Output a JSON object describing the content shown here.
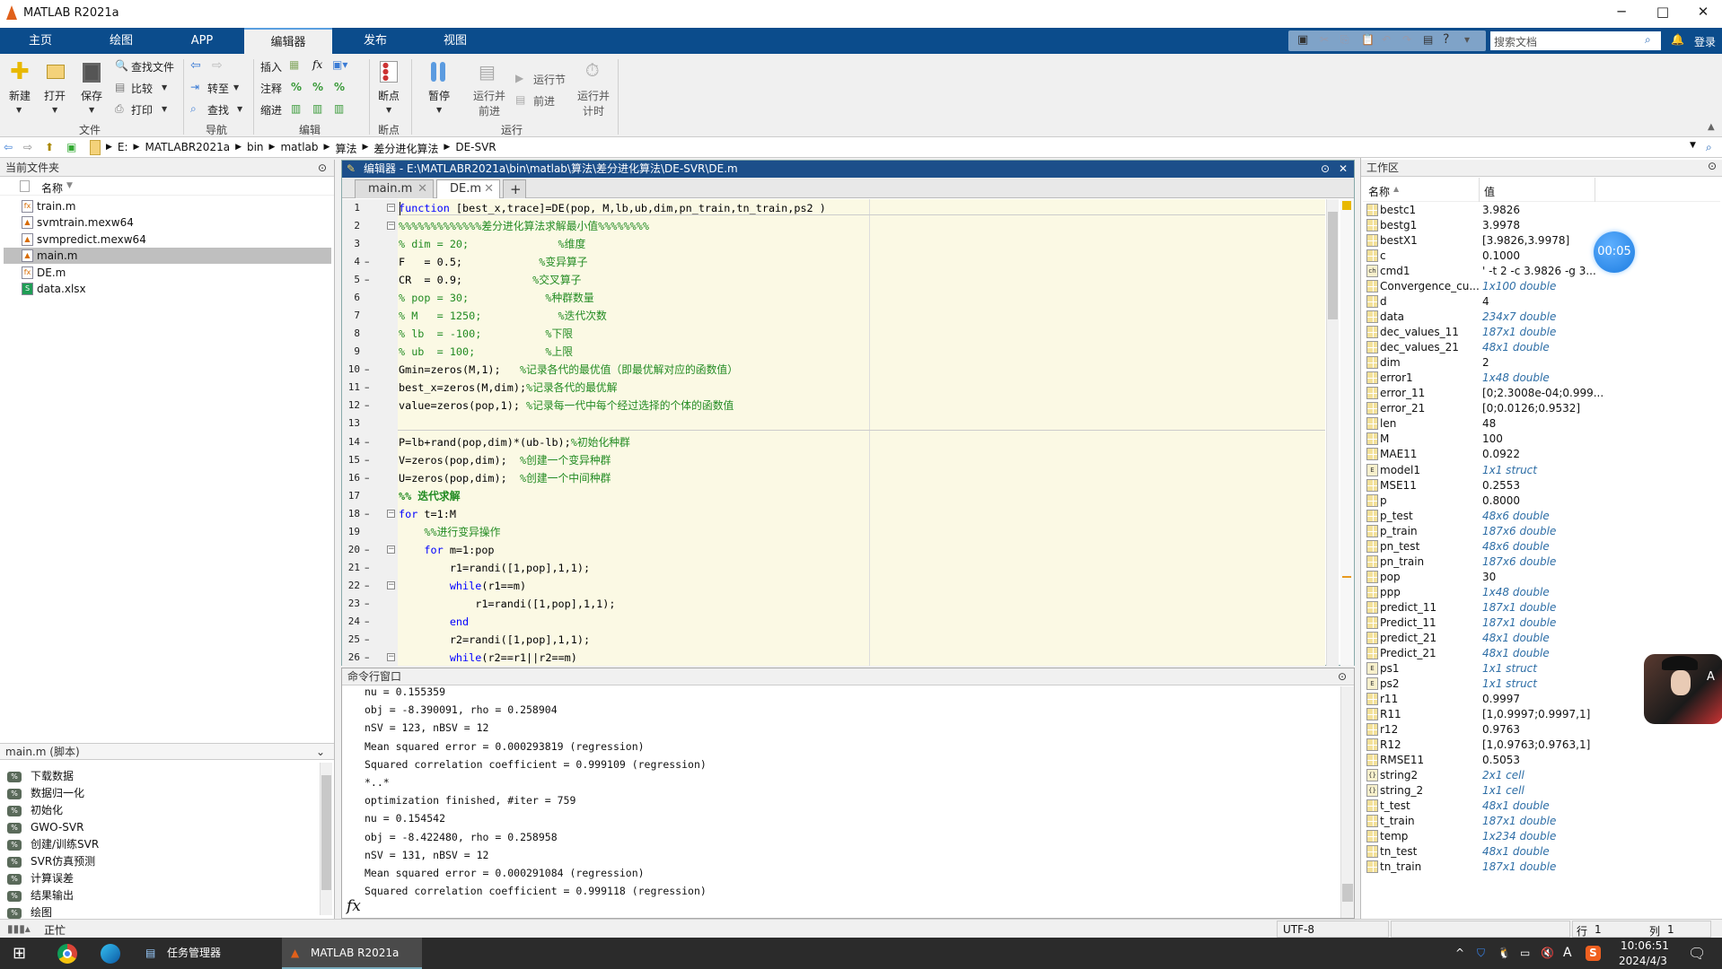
{
  "app": {
    "title": "MATLAB R2021a",
    "window_controls": {
      "minimize": "─",
      "maximize": "□",
      "close": "✕"
    }
  },
  "ribbon_tabs": [
    {
      "label": "主页"
    },
    {
      "label": "绘图"
    },
    {
      "label": "APP"
    },
    {
      "label": "编辑器",
      "selected": true
    },
    {
      "label": "发布"
    },
    {
      "label": "视图"
    }
  ],
  "quick_access": {
    "search_placeholder": "搜索文档",
    "login": "登录"
  },
  "ribbon": {
    "file": {
      "new": "新建",
      "open": "打开",
      "save": "保存",
      "find_files": "查找文件",
      "compare": "比较",
      "print": "打印",
      "group": "文件"
    },
    "nav": {
      "goto": "转至",
      "find": "查找",
      "group": "导航"
    },
    "edit": {
      "insert": "插入",
      "fx": "fx",
      "comment": "注释",
      "indent": "缩进",
      "group": "编辑",
      "percent": "%"
    },
    "breakpoints": {
      "label": "断点",
      "group": "断点"
    },
    "run": {
      "pause": "暂停",
      "run_advance_1": "运行并",
      "run_advance_2": "前进",
      "run_section": "运行节",
      "advance": "前进",
      "run_time_1": "运行并",
      "run_time_2": "计时",
      "group": "运行"
    }
  },
  "address": {
    "crumbs": [
      "E:",
      "MATLABR2021a",
      "bin",
      "matlab",
      "算法",
      "差分进化算法",
      "DE-SVR"
    ]
  },
  "current_folder": {
    "title": "当前文件夹",
    "column": "名称",
    "files": [
      {
        "name": "train.m",
        "icon": "function-file"
      },
      {
        "name": "svmtrain.mexw64",
        "icon": "mex-file"
      },
      {
        "name": "svmpredict.mexw64",
        "icon": "mex-file"
      },
      {
        "name": "main.m",
        "icon": "script-file",
        "selected": true
      },
      {
        "name": "DE.m",
        "icon": "function-file"
      },
      {
        "name": "data.xlsx",
        "icon": "excel-file"
      }
    ]
  },
  "details": {
    "title": "main.m  (脚本)",
    "sections": [
      "下载数据",
      "数据归一化",
      "初始化",
      "GWO-SVR",
      "创建/训练SVR",
      "SVR仿真预测",
      "计算误差",
      "结果输出",
      "绘图"
    ]
  },
  "editor": {
    "title": "编辑器 - E:\\MATLABR2021a\\bin\\matlab\\算法\\差分进化算法\\DE-SVR\\DE.m",
    "tabs": [
      {
        "label": "main.m"
      },
      {
        "label": "DE.m",
        "selected": true
      }
    ],
    "add_tab": "+",
    "lines": [
      {
        "n": "1",
        "fold": true,
        "s": [
          [
            "kw",
            "function"
          ],
          [
            "tx",
            " [best_x,trace]=DE(pop, M,lb,ub,dim,pn_train,tn_train,ps2 )"
          ]
        ]
      },
      {
        "n": "2",
        "fold": true,
        "s": [
          [
            "cm",
            "%%%%%%%%%%%%%差分进化算法求解最小值%%%%%%%%"
          ]
        ]
      },
      {
        "n": "3",
        "s": [
          [
            "cm",
            "% dim = 20;              %维度"
          ]
        ]
      },
      {
        "n": "4",
        "exec": true,
        "s": [
          [
            "tx",
            "F   = 0.5;            "
          ],
          [
            "cm",
            "%变异算子"
          ]
        ]
      },
      {
        "n": "5",
        "exec": true,
        "s": [
          [
            "tx",
            "CR  = 0.9;           "
          ],
          [
            "cm",
            "%交叉算子"
          ]
        ]
      },
      {
        "n": "6",
        "s": [
          [
            "cm",
            "% pop = 30;            %种群数量"
          ]
        ]
      },
      {
        "n": "7",
        "s": [
          [
            "cm",
            "% M   = 1250;            %迭代次数"
          ]
        ]
      },
      {
        "n": "8",
        "s": [
          [
            "cm",
            "% lb  = -100;          %下限"
          ]
        ]
      },
      {
        "n": "9",
        "s": [
          [
            "cm",
            "% ub  = 100;           %上限"
          ]
        ]
      },
      {
        "n": "10",
        "exec": true,
        "s": [
          [
            "tx",
            "Gmin=zeros(M,1);   "
          ],
          [
            "cm",
            "%记录各代的最优值（即最优解对应的函数值）"
          ]
        ]
      },
      {
        "n": "11",
        "exec": true,
        "s": [
          [
            "tx",
            "best_x=zeros(M,dim);"
          ],
          [
            "cm",
            "%记录各代的最优解"
          ]
        ]
      },
      {
        "n": "12",
        "exec": true,
        "s": [
          [
            "tx",
            "value=zeros(pop,1); "
          ],
          [
            "cm",
            "%记录每一代中每个经过选择的个体的函数值"
          ]
        ]
      },
      {
        "n": "13",
        "s": []
      },
      {
        "n": "14",
        "exec": true,
        "s": [
          [
            "tx",
            "P=lb+rand(pop,dim)*(ub-lb);"
          ],
          [
            "cm",
            "%初始化种群"
          ]
        ]
      },
      {
        "n": "15",
        "exec": true,
        "s": [
          [
            "tx",
            "V=zeros(pop,dim);  "
          ],
          [
            "cm",
            "%创建一个变异种群"
          ]
        ]
      },
      {
        "n": "16",
        "exec": true,
        "s": [
          [
            "tx",
            "U=zeros(pop,dim);  "
          ],
          [
            "cm",
            "%创建一个中间种群"
          ]
        ]
      },
      {
        "n": "17",
        "s": [
          [
            "sec",
            "%% 迭代求解"
          ]
        ]
      },
      {
        "n": "18",
        "exec": true,
        "fold": true,
        "s": [
          [
            "kw",
            "for"
          ],
          [
            "tx",
            " t=1:M"
          ]
        ]
      },
      {
        "n": "19",
        "s": [
          [
            "cm",
            "    %%进行变异操作"
          ]
        ]
      },
      {
        "n": "20",
        "exec": true,
        "fold": true,
        "s": [
          [
            "kw",
            "    for"
          ],
          [
            "tx",
            " m=1:pop"
          ]
        ]
      },
      {
        "n": "21",
        "exec": true,
        "s": [
          [
            "tx",
            "        r1=randi([1,pop],1,1);"
          ]
        ]
      },
      {
        "n": "22",
        "exec": true,
        "fold": true,
        "s": [
          [
            "kw",
            "        while"
          ],
          [
            "tx",
            "(r1==m)"
          ]
        ]
      },
      {
        "n": "23",
        "exec": true,
        "s": [
          [
            "tx",
            "            r1=randi([1,pop],1,1);"
          ]
        ]
      },
      {
        "n": "24",
        "exec": true,
        "s": [
          [
            "kw",
            "        end"
          ]
        ]
      },
      {
        "n": "25",
        "exec": true,
        "s": [
          [
            "tx",
            "        r2=randi([1,pop],1,1);"
          ]
        ]
      },
      {
        "n": "26",
        "exec": true,
        "fold": true,
        "s": [
          [
            "kw",
            "        while"
          ],
          [
            "tx",
            "(r2==r1||r2==m)"
          ]
        ]
      }
    ]
  },
  "command_window": {
    "title": "命令行窗口",
    "prompt": "fx",
    "lines": [
      "nu = 0.155359",
      "obj = -8.390091, rho = 0.258904",
      "nSV = 123, nBSV = 12",
      "Mean squared error = 0.000293819 (regression)",
      "Squared correlation coefficient = 0.999109 (regression)",
      "*..*",
      "optimization finished, #iter = 759",
      "nu = 0.154542",
      "obj = -8.422480, rho = 0.258958",
      "nSV = 131, nBSV = 12",
      "Mean squared error = 0.000291084 (regression)",
      "Squared correlation coefficient = 0.999118 (regression)"
    ]
  },
  "workspace": {
    "title": "工作区",
    "col_name": "名称",
    "col_value": "值",
    "timer": "00:05",
    "vars": [
      {
        "name": "bestc1",
        "value": "3.9826",
        "icon": "matrix"
      },
      {
        "name": "bestg1",
        "value": "3.9978",
        "icon": "matrix"
      },
      {
        "name": "bestX1",
        "value": "[3.9826,3.9978]",
        "icon": "matrix"
      },
      {
        "name": "c",
        "value": "0.1000",
        "icon": "matrix"
      },
      {
        "name": "cmd1",
        "value": "' -t 2 -c 3.9826 -g 3...",
        "icon": "char"
      },
      {
        "name": "Convergence_cu...",
        "value": "1x100 double",
        "icon": "matrix",
        "italic": true
      },
      {
        "name": "d",
        "value": "4",
        "icon": "matrix"
      },
      {
        "name": "data",
        "value": "234x7 double",
        "icon": "matrix",
        "italic": true
      },
      {
        "name": "dec_values_11",
        "value": "187x1 double",
        "icon": "matrix",
        "italic": true
      },
      {
        "name": "dec_values_21",
        "value": "48x1 double",
        "icon": "matrix",
        "italic": true
      },
      {
        "name": "dim",
        "value": "2",
        "icon": "matrix"
      },
      {
        "name": "error1",
        "value": "1x48 double",
        "icon": "matrix",
        "italic": true
      },
      {
        "name": "error_11",
        "value": "[0;2.3008e-04;0.999...",
        "icon": "matrix"
      },
      {
        "name": "error_21",
        "value": "[0;0.0126;0.9532]",
        "icon": "matrix"
      },
      {
        "name": "len",
        "value": "48",
        "icon": "matrix"
      },
      {
        "name": "M",
        "value": "100",
        "icon": "matrix"
      },
      {
        "name": "MAE11",
        "value": "0.0922",
        "icon": "matrix"
      },
      {
        "name": "model1",
        "value": "1x1 struct",
        "icon": "struct",
        "italic": true
      },
      {
        "name": "MSE11",
        "value": "0.2553",
        "icon": "matrix"
      },
      {
        "name": "p",
        "value": "0.8000",
        "icon": "matrix"
      },
      {
        "name": "p_test",
        "value": "48x6 double",
        "icon": "matrix",
        "italic": true
      },
      {
        "name": "p_train",
        "value": "187x6 double",
        "icon": "matrix",
        "italic": true
      },
      {
        "name": "pn_test",
        "value": "48x6 double",
        "icon": "matrix",
        "italic": true
      },
      {
        "name": "pn_train",
        "value": "187x6 double",
        "icon": "matrix",
        "italic": true
      },
      {
        "name": "pop",
        "value": "30",
        "icon": "matrix"
      },
      {
        "name": "ppp",
        "value": "1x48 double",
        "icon": "matrix",
        "italic": true
      },
      {
        "name": "predict_11",
        "value": "187x1 double",
        "icon": "matrix",
        "italic": true
      },
      {
        "name": "Predict_11",
        "value": "187x1 double",
        "icon": "matrix",
        "italic": true
      },
      {
        "name": "predict_21",
        "value": "48x1 double",
        "icon": "matrix",
        "italic": true
      },
      {
        "name": "Predict_21",
        "value": "48x1 double",
        "icon": "matrix",
        "italic": true
      },
      {
        "name": "ps1",
        "value": "1x1 struct",
        "icon": "struct",
        "italic": true
      },
      {
        "name": "ps2",
        "value": "1x1 struct",
        "icon": "struct",
        "italic": true
      },
      {
        "name": "r11",
        "value": "0.9997",
        "icon": "matrix"
      },
      {
        "name": "R11",
        "value": "[1,0.9997;0.9997,1]",
        "icon": "matrix"
      },
      {
        "name": "r12",
        "value": "0.9763",
        "icon": "matrix"
      },
      {
        "name": "R12",
        "value": "[1,0.9763;0.9763,1]",
        "icon": "matrix"
      },
      {
        "name": "RMSE11",
        "value": "0.5053",
        "icon": "matrix"
      },
      {
        "name": "string2",
        "value": "2x1 cell",
        "icon": "cell",
        "italic": true
      },
      {
        "name": "string_2",
        "value": "1x1 cell",
        "icon": "cell",
        "italic": true
      },
      {
        "name": "t_test",
        "value": "48x1 double",
        "icon": "matrix",
        "italic": true
      },
      {
        "name": "t_train",
        "value": "187x1 double",
        "icon": "matrix",
        "italic": true
      },
      {
        "name": "temp",
        "value": "1x234 double",
        "icon": "matrix",
        "italic": true
      },
      {
        "name": "tn_test",
        "value": "48x1 double",
        "icon": "matrix",
        "italic": true
      },
      {
        "name": "tn_train",
        "value": "187x1 double",
        "icon": "matrix",
        "italic": true
      }
    ]
  },
  "status": {
    "busy": "正忙",
    "encoding": "UTF-8",
    "row_label": "行",
    "row": "1",
    "col_label": "列",
    "col": "1"
  },
  "taskbar": {
    "apps": [
      {
        "label": "任务管理器"
      },
      {
        "label": "MATLAB R2021a",
        "active": true
      }
    ],
    "time": "10:06:51",
    "date": "2024/4/3",
    "ime": "A"
  },
  "colors": {
    "ribbon_blue": "#0b4c8c",
    "editor_title": "#1c4f8a",
    "keyword": "#0000ff",
    "comment": "#228b22",
    "code_bg": "#fbf9e4"
  }
}
